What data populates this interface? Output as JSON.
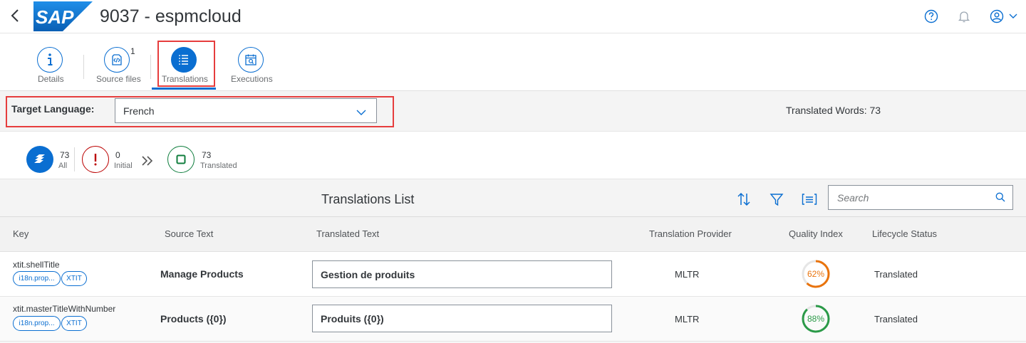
{
  "shell": {
    "title": "9037 - espmcloud",
    "logo_text": "SAP",
    "icons": [
      "back-icon",
      "help-icon",
      "notification-bell-icon",
      "user-avatar-icon",
      "chevron-down-icon"
    ]
  },
  "tabs": [
    {
      "label": "Details",
      "icon": "info-icon"
    },
    {
      "label": "Source files",
      "icon": "source-code-icon",
      "count": "1"
    },
    {
      "label": "Translations",
      "icon": "list-icon",
      "selected": true
    },
    {
      "label": "Executions",
      "icon": "calendar-search-icon"
    }
  ],
  "filter": {
    "label": "Target Language:",
    "value": "French",
    "translated_words": "Translated Words: 73"
  },
  "flow": [
    {
      "count": "73",
      "label": "All",
      "icon": "all-stack-icon"
    },
    {
      "count": "0",
      "label": "Initial",
      "icon": "exclamation-icon"
    },
    {
      "count": "73",
      "label": "Translated",
      "icon": "square-icon"
    }
  ],
  "table": {
    "title": "Translations List",
    "search_placeholder": "Search",
    "columns": [
      "Key",
      "Source Text",
      "Translated Text",
      "Translation Provider",
      "Quality Index",
      "Lifecycle Status"
    ],
    "rows": [
      {
        "key": "xtit.shellTitle",
        "chips": [
          "i18n.prop...",
          "XTIT"
        ],
        "source": "Manage Products",
        "translated": "Gestion de produits",
        "provider": "MLTR",
        "quality": "62%",
        "quality_value": 62,
        "status": "Translated"
      },
      {
        "key": "xtit.masterTitleWithNumber",
        "chips": [
          "i18n.prop...",
          "XTIT"
        ],
        "source": "Products ({0})",
        "translated": "Produits ({0})",
        "provider": "MLTR",
        "quality": "88%",
        "quality_value": 88,
        "status": "Translated"
      }
    ]
  },
  "colors": {
    "brand": "#0a6ed1",
    "highlight": "#e63d3d",
    "error": "#bb0000",
    "success": "#107e3e",
    "quality_medium": "#e9730c",
    "quality_good": "#2b9a48"
  }
}
